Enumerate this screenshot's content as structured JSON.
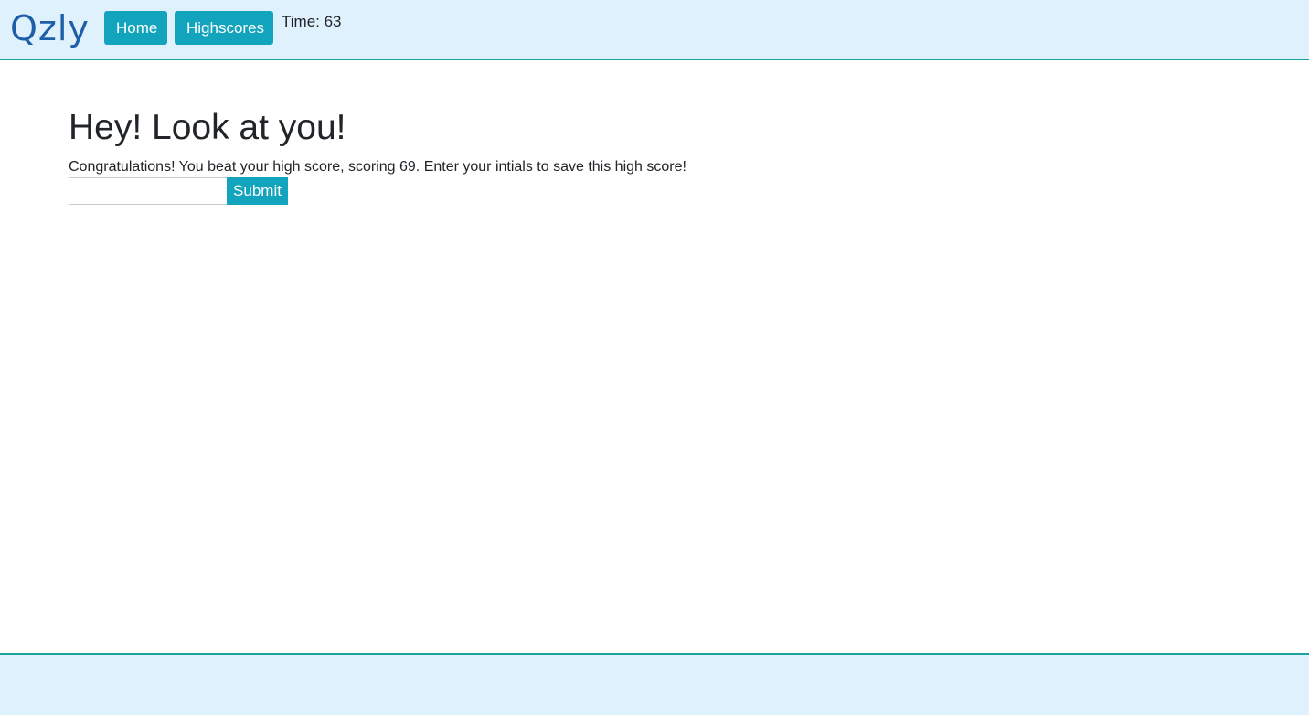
{
  "header": {
    "logo_text": "Qzly",
    "nav": {
      "home_label": "Home",
      "highscores_label": "Highscores"
    },
    "timer_text": "Time: 63"
  },
  "main": {
    "title": "Hey! Look at you!",
    "message": "Congratulations! You beat your high score, scoring 69. Enter your intials to save this high score!",
    "initials_input": {
      "value": "",
      "placeholder": ""
    },
    "submit_label": "Submit"
  },
  "colors": {
    "header_bg": "#dff1fd",
    "accent_border": "#17a2a0",
    "button_bg": "#12a4bd",
    "logo_color": "#1f5fa8",
    "text": "#212529"
  }
}
